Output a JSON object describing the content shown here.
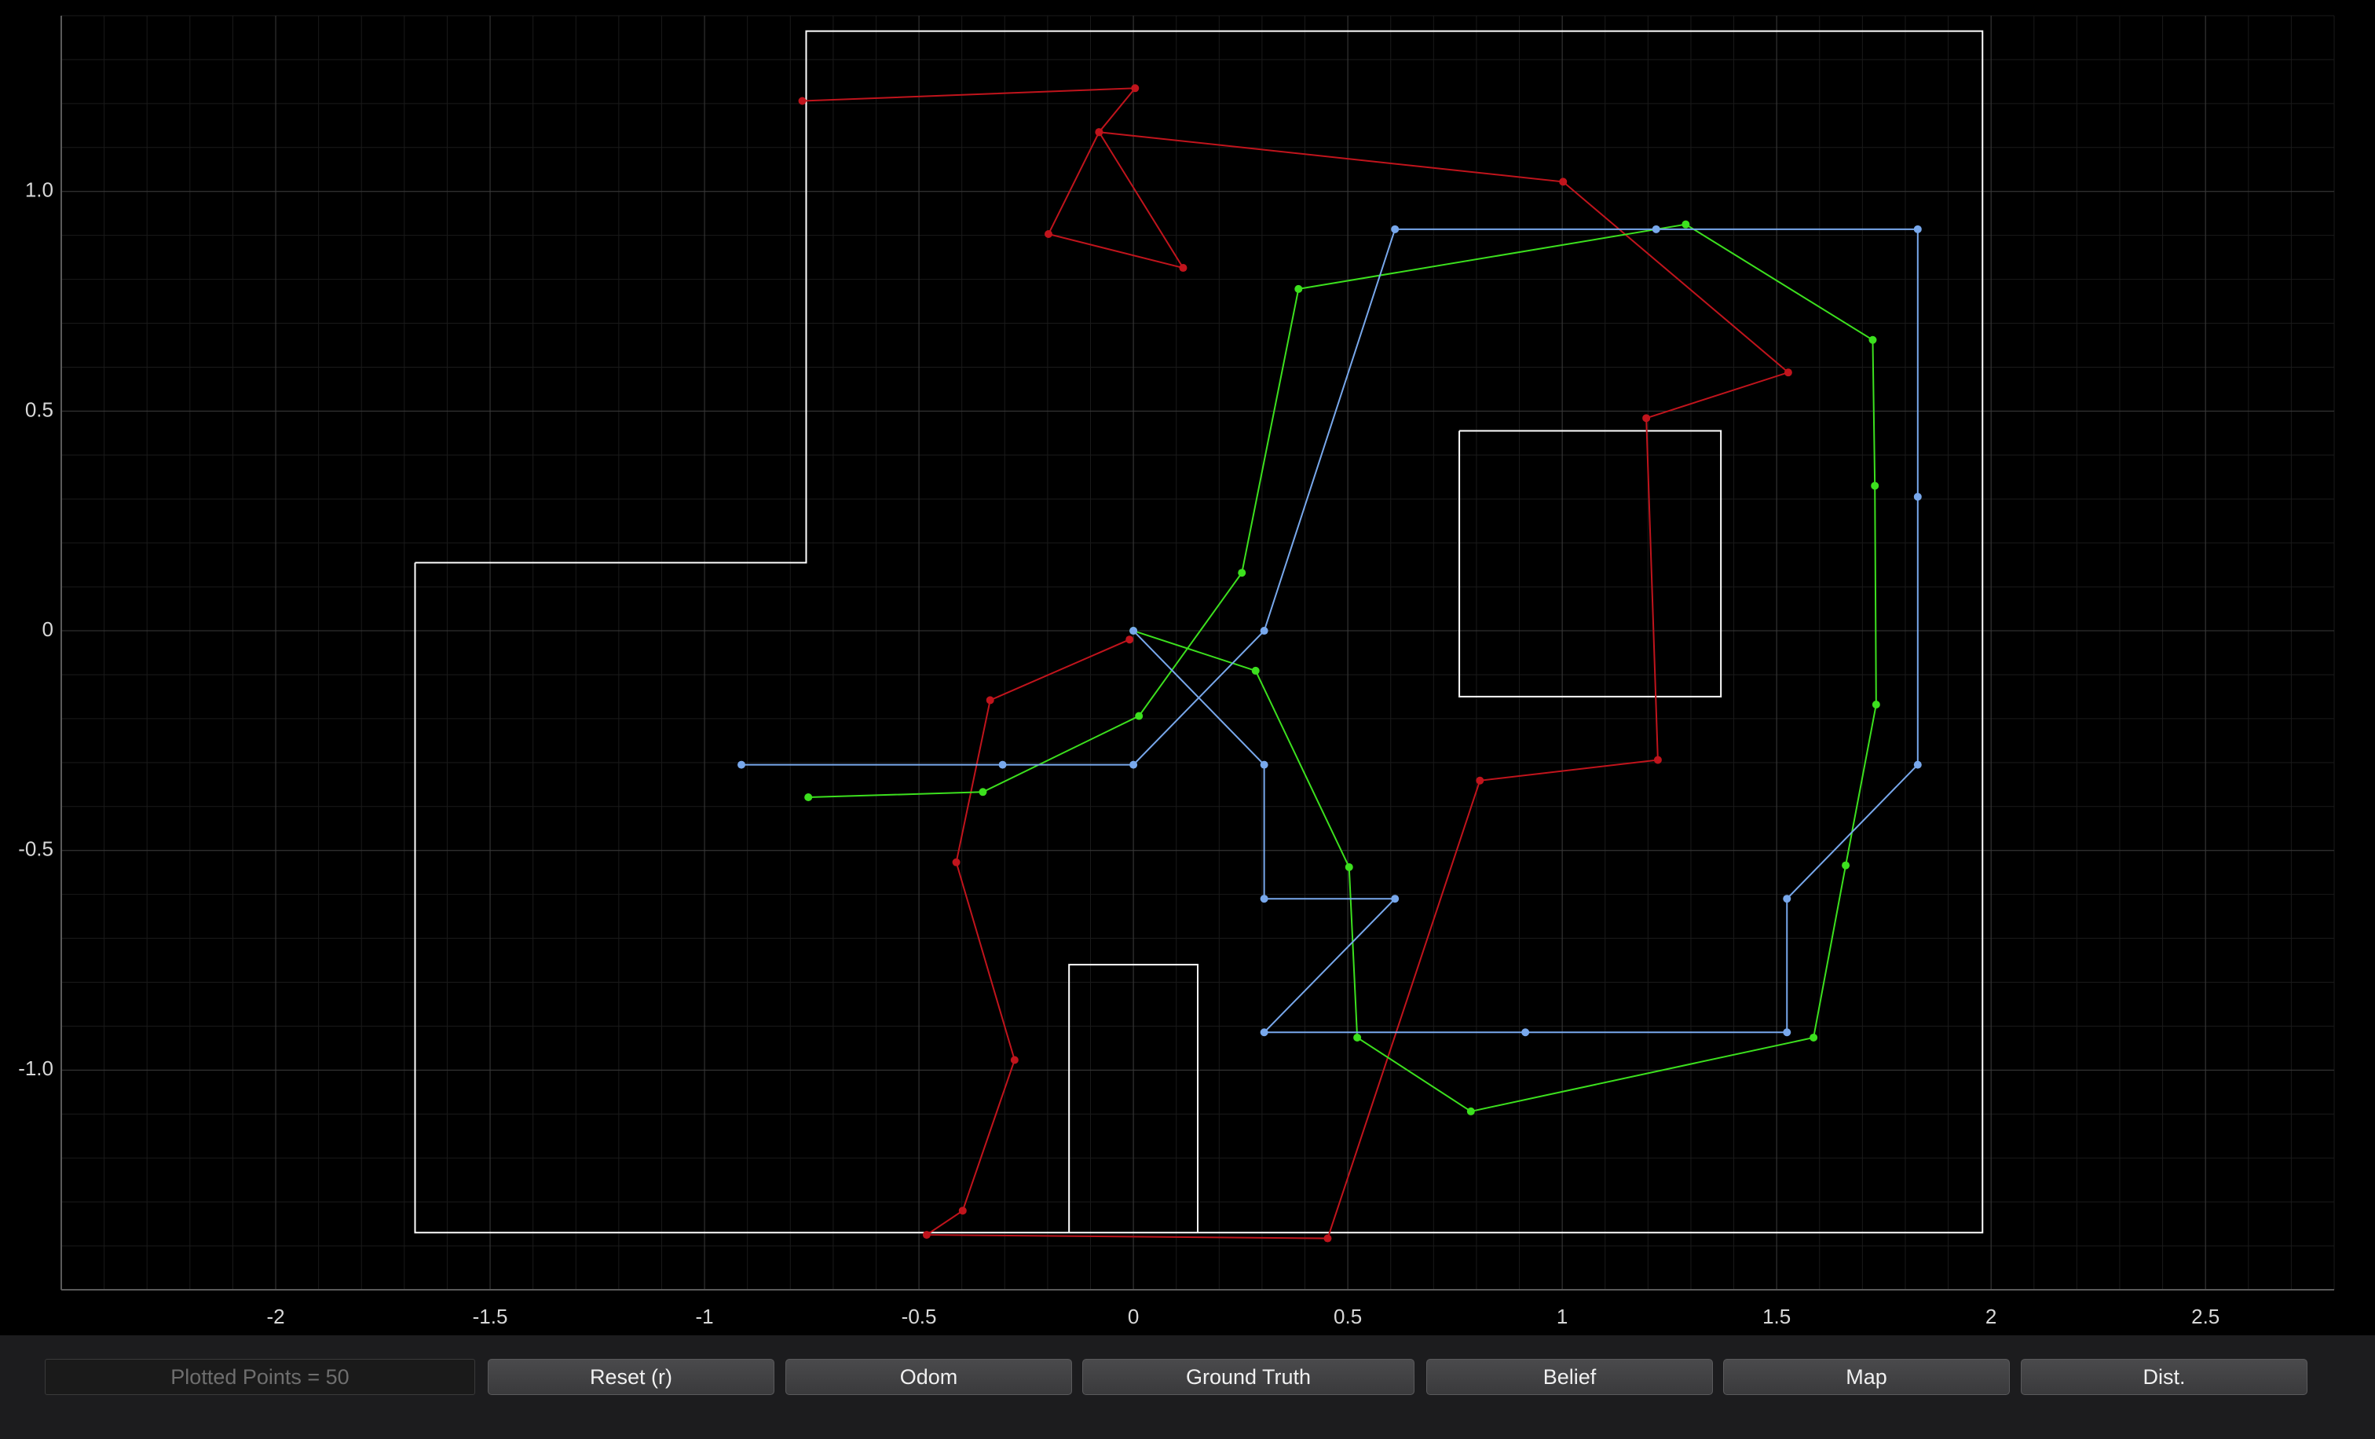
{
  "status": {
    "plotted_points_label": "Plotted Points = 50"
  },
  "buttons": {
    "reset": "Reset (r)",
    "odom": "Odom",
    "ground_truth": "Ground Truth",
    "belief": "Belief",
    "map": "Map",
    "dist": "Dist."
  },
  "colors": {
    "background": "#000000",
    "grid_major": "#3a3a3a",
    "grid_minor": "#1a1a1a",
    "axis": "#5a5a5a",
    "map_lines": "#ffffff",
    "odom": "#c0141c",
    "ground_truth": "#3ce01e",
    "belief": "#78a8ec"
  },
  "chart_data": {
    "type": "line",
    "grid": true,
    "xlim": [
      -2.5,
      2.8
    ],
    "ylim": [
      -1.5,
      1.4
    ],
    "x_ticks": [
      {
        "v": -2,
        "label": "-2"
      },
      {
        "v": -1.5,
        "label": "-1.5"
      },
      {
        "v": -1,
        "label": "-1"
      },
      {
        "v": -0.5,
        "label": "-0.5"
      },
      {
        "v": 0,
        "label": "0"
      },
      {
        "v": 0.5,
        "label": "0.5"
      },
      {
        "v": 1,
        "label": "1"
      },
      {
        "v": 1.5,
        "label": "1.5"
      },
      {
        "v": 2,
        "label": "2"
      },
      {
        "v": 2.5,
        "label": "2.5"
      }
    ],
    "y_ticks": [
      {
        "v": 1.0,
        "label": "1.0"
      },
      {
        "v": 0.5,
        "label": "0.5"
      },
      {
        "v": 0,
        "label": "0"
      },
      {
        "v": -0.5,
        "label": "-0.5"
      },
      {
        "v": -1.0,
        "label": "-1.0"
      }
    ],
    "map_segments": [
      [
        [
          -1.675,
          0.155
        ],
        [
          -0.763,
          0.155
        ],
        [
          -0.763,
          1.365
        ],
        [
          1.98,
          1.365
        ],
        [
          1.98,
          -1.37
        ],
        [
          -1.675,
          -1.37
        ],
        [
          -1.675,
          0.155
        ]
      ],
      [
        [
          0.76,
          0.455
        ],
        [
          1.37,
          0.455
        ],
        [
          1.37,
          -0.15
        ],
        [
          0.76,
          -0.15
        ],
        [
          0.76,
          0.455
        ]
      ],
      [
        [
          -0.15,
          -1.37
        ],
        [
          -0.15,
          -0.76
        ],
        [
          0.15,
          -0.76
        ],
        [
          0.15,
          -1.37
        ]
      ]
    ],
    "series": [
      {
        "key": "odom",
        "points": [
          [
            -0.772,
            1.206
          ],
          [
            0.004,
            1.235
          ],
          [
            -0.08,
            1.135
          ],
          [
            -0.198,
            0.903
          ],
          [
            0.116,
            0.826
          ],
          [
            -0.08,
            1.135
          ],
          [
            1.002,
            1.022
          ],
          [
            1.527,
            0.588
          ],
          [
            1.196,
            0.484
          ],
          [
            1.223,
            -0.294
          ],
          [
            0.808,
            -0.341
          ],
          [
            0.453,
            -1.383
          ],
          [
            -0.482,
            -1.375
          ],
          [
            -0.398,
            -1.32
          ],
          [
            -0.277,
            -0.977
          ],
          [
            -0.413,
            -0.527
          ],
          [
            -0.334,
            -0.158
          ],
          [
            -0.009,
            -0.02
          ]
        ]
      },
      {
        "key": "ground_truth",
        "points": [
          [
            -0.758,
            -0.379
          ],
          [
            -0.351,
            -0.367
          ],
          [
            0.013,
            -0.194
          ],
          [
            0.253,
            0.132
          ],
          [
            0.385,
            0.778
          ],
          [
            1.288,
            0.925
          ],
          [
            1.724,
            0.662
          ],
          [
            1.729,
            0.33
          ],
          [
            1.732,
            -0.168
          ],
          [
            1.661,
            -0.534
          ],
          [
            1.586,
            -0.926
          ],
          [
            0.787,
            -1.094
          ],
          [
            0.522,
            -0.926
          ],
          [
            0.503,
            -0.538
          ],
          [
            0.285,
            -0.091
          ],
          [
            0.0,
            0.0
          ]
        ]
      },
      {
        "key": "belief",
        "points": [
          [
            -0.914,
            -0.305
          ],
          [
            -0.305,
            -0.305
          ],
          [
            0.0,
            -0.305
          ],
          [
            0.305,
            0.0
          ],
          [
            0.61,
            0.914
          ],
          [
            1.219,
            0.914
          ],
          [
            1.829,
            0.914
          ],
          [
            1.829,
            0.305
          ],
          [
            1.829,
            -0.305
          ],
          [
            1.524,
            -0.61
          ],
          [
            1.524,
            -0.914
          ],
          [
            0.914,
            -0.914
          ],
          [
            0.305,
            -0.914
          ],
          [
            0.61,
            -0.61
          ],
          [
            0.305,
            -0.61
          ],
          [
            0.305,
            -0.305
          ],
          [
            0.0,
            0.0
          ]
        ]
      }
    ]
  }
}
